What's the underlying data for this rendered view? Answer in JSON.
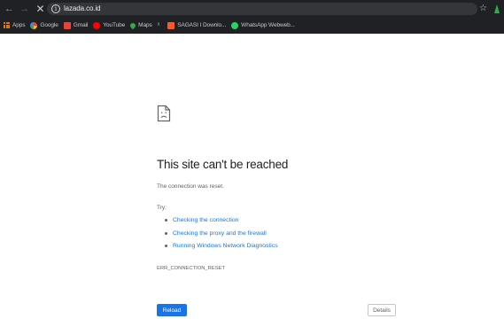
{
  "browser": {
    "url": "lazada.co.id",
    "bookmarks": [
      {
        "label": "Apps",
        "icon": "apps-grid-icon"
      },
      {
        "label": "Google",
        "icon": "google-icon"
      },
      {
        "label": "Gmail",
        "icon": "gmail-icon"
      },
      {
        "label": "YouTube",
        "icon": "youtube-icon"
      },
      {
        "label": "Maps",
        "icon": "maps-icon"
      },
      {
        "label": "",
        "icon": "translate-icon"
      },
      {
        "label": "SAGASI I Downlo...",
        "icon": "sagasi-icon"
      },
      {
        "label": "WhatsApp Webweb...",
        "icon": "whatsapp-icon"
      }
    ],
    "colors": {
      "chrome_bg": "#202124",
      "omnibox_bg": "#35363a"
    }
  },
  "error_page": {
    "title": "This site can't be reached",
    "description": "The connection was reset.",
    "try_label": "Try:",
    "suggestions": [
      "Checking the connection",
      "Checking the proxy and the firewall",
      "Running Windows Network Diagnostics"
    ],
    "error_code": "ERR_CONNECTION_RESET",
    "reload_label": "Reload",
    "details_label": "Details",
    "colors": {
      "link": "#1a73e8",
      "primary_button": "#1a73e8",
      "title": "#202124",
      "text": "#5f6368"
    }
  }
}
